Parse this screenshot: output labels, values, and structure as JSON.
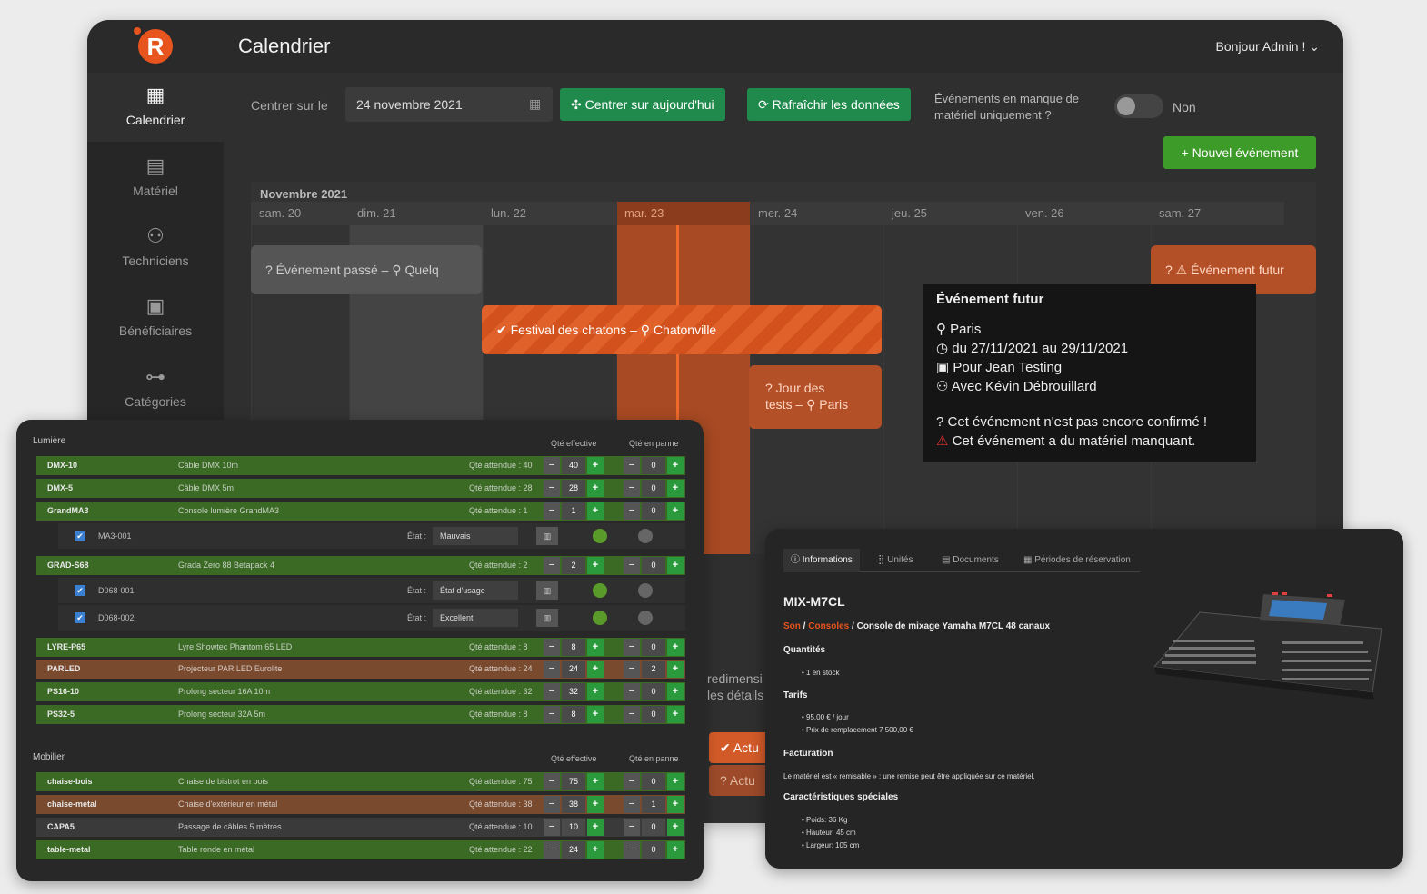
{
  "app": {
    "logo_letter": "R",
    "title": "Calendrier",
    "user_greeting": "Bonjour Admin ! ⌄"
  },
  "sidebar": {
    "items": [
      {
        "label": "Calendrier",
        "icon": "calendar-icon",
        "glyph": "▦",
        "active": true
      },
      {
        "label": "Matériel",
        "icon": "box-icon",
        "glyph": "▤"
      },
      {
        "label": "Techniciens",
        "icon": "people-icon",
        "glyph": "⚇"
      },
      {
        "label": "Bénéficiaires",
        "icon": "address-card-icon",
        "glyph": "▣"
      },
      {
        "label": "Catégories",
        "icon": "sitemap-icon",
        "glyph": "⊶"
      }
    ]
  },
  "toolbar": {
    "center_label": "Centrer sur le",
    "date_value": "24 novembre 2021",
    "today_button": "✣ Centrer sur aujourd'hui",
    "refresh_button": "⟳ Rafraîchir les données",
    "filter_label": "Événements en manque de matériel uniquement ?",
    "filter_value": "Non",
    "new_event_button": "+ Nouvel événement"
  },
  "calendar": {
    "month": "Novembre 2021",
    "days": [
      "sam. 20",
      "dim. 21",
      "lun. 22",
      "mar. 23",
      "mer. 24",
      "jeu. 25",
      "ven. 26",
      "sam. 27"
    ],
    "today_index": 3,
    "events": {
      "past": "? Événement passé – ⚲ Quelq",
      "festival": "✔ Festival des chatons – ⚲ Chatonville",
      "test_line1": "? Jour des",
      "test_line2": "tests – ⚲ Paris",
      "future": "? ⚠ Événement futur"
    }
  },
  "tooltip": {
    "title": "Événement futur",
    "location": "Paris",
    "dates": "du 27/11/2021 au 29/11/2021",
    "beneficiary": "Pour Jean Testing",
    "technician": "Avec Kévin Débrouillard",
    "unconfirmed": "Cet événement n'est pas encore confirmé !",
    "missing": "Cet événement a du matériel manquant."
  },
  "inventory": {
    "lumiere_title": "Lumière",
    "mobilier_title": "Mobilier",
    "col_effective": "Qté effective",
    "col_broken": "Qté en panne",
    "state_label": "État :",
    "lumiere_rows": [
      {
        "ref": "DMX-10",
        "name": "Câble DMX 10m",
        "qa": "Qté attendue : 40",
        "eff": "40",
        "broken": "0",
        "color": "g"
      },
      {
        "ref": "DMX-5",
        "name": "Câble DMX 5m",
        "qa": "Qté attendue : 28",
        "eff": "28",
        "broken": "0",
        "color": "g"
      },
      {
        "ref": "GrandMA3",
        "name": "Console lumière GrandMA3",
        "qa": "Qté attendue : 1",
        "eff": "1",
        "broken": "0",
        "color": "g"
      },
      {
        "ref": "GRAD-S68",
        "name": "Gradа Zero 88 Betapack 4",
        "qa": "Qté attendue : 2",
        "eff": "2",
        "broken": "0",
        "color": "g"
      },
      {
        "ref": "LYRE-P65",
        "name": "Lyre Showtec Phantom 65 LED",
        "qa": "Qté attendue : 8",
        "eff": "8",
        "broken": "0",
        "color": "g"
      },
      {
        "ref": "PARLED",
        "name": "Projecteur PAR LED Eurolite",
        "qa": "Qté attendue : 24",
        "eff": "24",
        "broken": "2",
        "color": "o"
      },
      {
        "ref": "PS16-10",
        "name": "Prolong secteur 16A 10m",
        "qa": "Qté attendue : 32",
        "eff": "32",
        "broken": "0",
        "color": "g"
      },
      {
        "ref": "PS32-5",
        "name": "Prolong secteur 32A 5m",
        "qa": "Qté attendue : 8",
        "eff": "8",
        "broken": "0",
        "color": "g"
      }
    ],
    "units": [
      {
        "ref": "MA3-001",
        "state": "Mauvais"
      },
      {
        "ref": "D068-001",
        "state": "État d'usage"
      },
      {
        "ref": "D068-002",
        "state": "Excellent"
      }
    ],
    "mobilier_rows": [
      {
        "ref": "chaise-bois",
        "name": "Chaise de bistrot en bois",
        "qa": "Qté attendue : 75",
        "eff": "75",
        "broken": "0",
        "color": "g"
      },
      {
        "ref": "chaise-metal",
        "name": "Chaise d'extérieur en métal",
        "qa": "Qté attendue : 38",
        "eff": "38",
        "broken": "1",
        "color": "o"
      },
      {
        "ref": "CAPA5",
        "name": "Passage de câbles 5 mètres",
        "qa": "Qté attendue : 10",
        "eff": "10",
        "broken": "0",
        "color": "d"
      },
      {
        "ref": "table-metal",
        "name": "Table ronde en métal",
        "qa": "Qté attendue : 22",
        "eff": "24",
        "broken": "0",
        "color": "g"
      }
    ]
  },
  "background_partial": {
    "resize_line1": "redimensi",
    "resize_line2": "les détails",
    "btn1": "✔ Actu",
    "btn2": "? Actu"
  },
  "product": {
    "tabs": [
      "ⓘ Informations",
      "⣿ Unités",
      "▤ Documents",
      "▦ Périodes de réservation"
    ],
    "title": "MIX-M7CL",
    "crumb_cat": "Son",
    "crumb_sub": "Consoles",
    "crumb_name": "Console de mixage Yamaha M7CL 48 canaux",
    "quantities_h": "Quantités",
    "stock": "1 en stock",
    "tarifs_h": "Tarifs",
    "price_day": "95,00 € / jour",
    "replacement": "Prix de remplacement 7 500,00 €",
    "billing_h": "Facturation",
    "billing_txt": "Le matériel est « remisable » : une remise peut être appliquée sur ce matériel.",
    "special_h": "Caractéristiques spéciales",
    "weight": "Poids: 36 Kg",
    "height": "Hauteur: 45 cm",
    "width": "Largeur: 105 cm"
  },
  "colors": {
    "accent": "#e8541e",
    "green_btn": "#1f8a4c",
    "new_btn": "#3d9b2a",
    "row_green": "#3b6a25",
    "row_orange": "#7a4a2e"
  }
}
